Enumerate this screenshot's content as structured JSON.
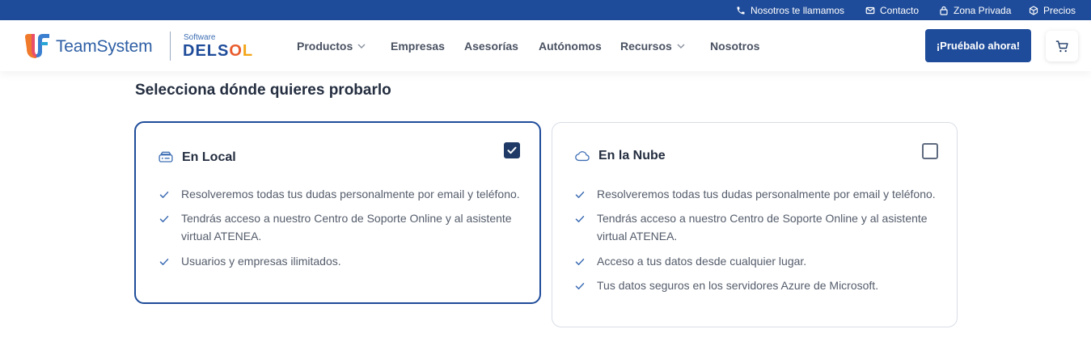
{
  "topbar": {
    "call": "Nosotros te llamamos",
    "contact": "Contacto",
    "private": "Zona Privada",
    "prices": "Precios"
  },
  "header": {
    "brand": "TeamSystem",
    "software_label": "Software",
    "delsol": {
      "a": "DELS",
      "b": "O",
      "c": "L"
    },
    "nav": [
      {
        "label": "Productos",
        "dropdown": true
      },
      {
        "label": "Empresas",
        "dropdown": false
      },
      {
        "label": "Asesorías",
        "dropdown": false
      },
      {
        "label": "Autónomos",
        "dropdown": false
      },
      {
        "label": "Recursos",
        "dropdown": true
      },
      {
        "label": "Nosotros",
        "dropdown": false
      }
    ],
    "cta": "¡Pruébalo ahora!",
    "cart_icon": "cart-icon"
  },
  "main": {
    "heading": "Selecciona dónde quieres probarlo",
    "options": [
      {
        "title": "En Local",
        "icon": "hard-drive-icon",
        "selected": true,
        "features": [
          "Resolveremos todas tus dudas personalmente por email y teléfono.",
          "Tendrás acceso a nuestro Centro de Soporte Online y al asistente virtual ATENEA.",
          "Usuarios y empresas ilimitados."
        ]
      },
      {
        "title": "En la Nube",
        "icon": "cloud-icon",
        "selected": false,
        "features": [
          "Resolveremos todas tus dudas personalmente por email y teléfono.",
          "Tendrás acceso a nuestro Centro de Soporte Online y al asistente virtual ATENEA.",
          "Acceso a tus datos desde cualquier lugar.",
          "Tus datos seguros en los servidores Azure de Microsoft."
        ]
      }
    ]
  },
  "colors": {
    "primary": "#1f4c9a",
    "text_dark": "#242e40",
    "text_body": "#545c6b",
    "check": "#3f6fb5"
  }
}
